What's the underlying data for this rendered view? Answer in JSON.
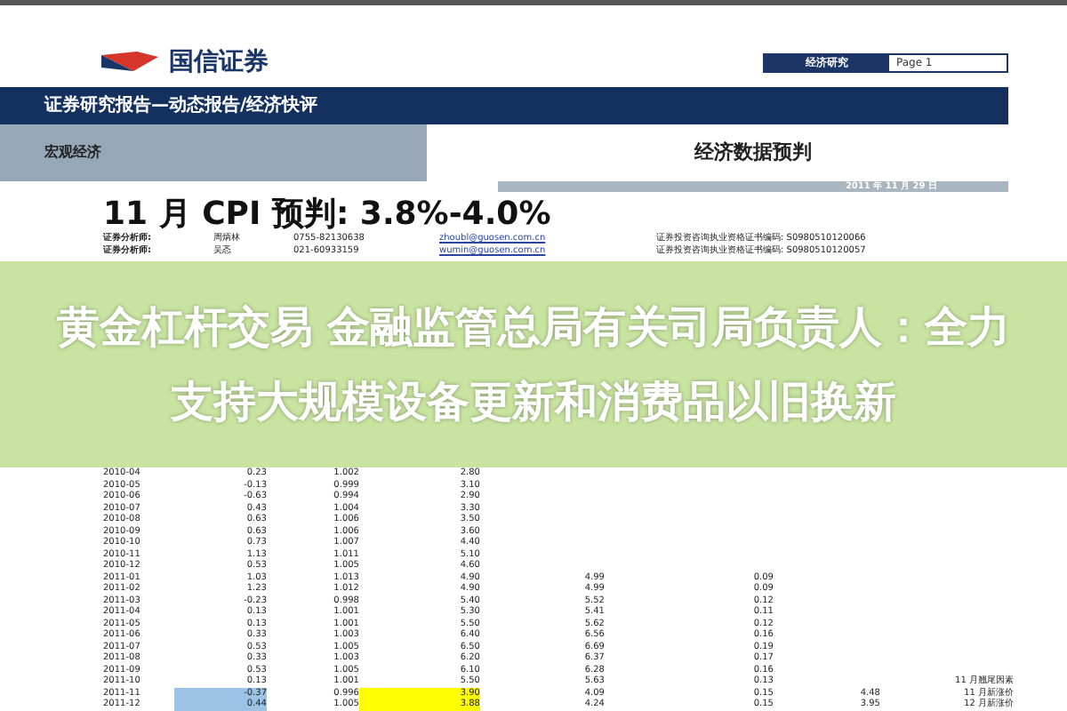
{
  "header": {
    "brand": "国信证券",
    "section_label": "经济研究",
    "page_label": "Page 1"
  },
  "banner": {
    "title": "证券研究报告—动态报告/经济快评"
  },
  "category": {
    "label": "宏观经济",
    "topic": "经济数据预判",
    "date": "2011 年 11 月 29 日"
  },
  "report_title": "11 月 CPI 预判:  3.8%-4.0%",
  "analysts": [
    {
      "role": "证券分析师:",
      "name": "周炳林",
      "phone": "0755-82130638",
      "email": "zhoubl@guosen.com.cn",
      "license": "证券投资咨询执业资格证书编码: S0980510120066"
    },
    {
      "role": "证券分析师:",
      "name": "吴忞",
      "phone": "021-60933159",
      "email": "wumin@guosen.com.cn",
      "license": "证券投资咨询执业资格证书编码: S0980510120057"
    }
  ],
  "headline": "黄金杠杆交易 金融监管总局有关司局负责人：全力支持大规模设备更新和消费品以旧换新",
  "table": {
    "rows": [
      {
        "cells": [
          "2010-04",
          "0.23",
          "1.002",
          "2.80",
          "",
          "",
          "",
          ""
        ],
        "marked": false
      },
      {
        "cells": [
          "2010-05",
          "-0.13",
          "0.999",
          "3.10",
          "",
          "",
          "",
          ""
        ],
        "marked": false
      },
      {
        "cells": [
          "2010-06",
          "-0.63",
          "0.994",
          "2.90",
          "",
          "",
          "",
          ""
        ],
        "marked": false
      },
      {
        "cells": [
          "2010-07",
          "0.43",
          "1.004",
          "3.30",
          "",
          "",
          "",
          ""
        ],
        "marked": false
      },
      {
        "cells": [
          "2010-08",
          "0.63",
          "1.006",
          "3.50",
          "",
          "",
          "",
          ""
        ],
        "marked": false
      },
      {
        "cells": [
          "2010-09",
          "0.63",
          "1.006",
          "3.60",
          "",
          "",
          "",
          ""
        ],
        "marked": false
      },
      {
        "cells": [
          "2010-10",
          "0.73",
          "1.007",
          "4.40",
          "",
          "",
          "",
          ""
        ],
        "marked": false
      },
      {
        "cells": [
          "2010-11",
          "1.13",
          "1.011",
          "5.10",
          "",
          "",
          "",
          ""
        ],
        "marked": false
      },
      {
        "cells": [
          "2010-12",
          "0.53",
          "1.005",
          "4.60",
          "",
          "",
          "",
          ""
        ],
        "marked": false
      },
      {
        "cells": [
          "2011-01",
          "1.03",
          "1.013",
          "4.90",
          "4.99",
          "0.09",
          "",
          ""
        ],
        "marked": false
      },
      {
        "cells": [
          "2011-02",
          "1.23",
          "1.012",
          "4.90",
          "4.99",
          "0.09",
          "",
          ""
        ],
        "marked": false
      },
      {
        "cells": [
          "2011-03",
          "-0.23",
          "0.998",
          "5.40",
          "5.52",
          "0.12",
          "",
          ""
        ],
        "marked": false
      },
      {
        "cells": [
          "2011-04",
          "0.13",
          "1.001",
          "5.30",
          "5.41",
          "0.11",
          "",
          ""
        ],
        "marked": false
      },
      {
        "cells": [
          "2011-05",
          "0.13",
          "1.001",
          "5.50",
          "5.62",
          "0.12",
          "",
          ""
        ],
        "marked": false
      },
      {
        "cells": [
          "2011-06",
          "0.33",
          "1.003",
          "6.40",
          "6.56",
          "0.16",
          "",
          ""
        ],
        "marked": false
      },
      {
        "cells": [
          "2011-07",
          "0.53",
          "1.005",
          "6.50",
          "6.69",
          "0.19",
          "",
          ""
        ],
        "marked": false
      },
      {
        "cells": [
          "2011-08",
          "0.33",
          "1.003",
          "6.20",
          "6.37",
          "0.17",
          "",
          ""
        ],
        "marked": false
      },
      {
        "cells": [
          "2011-09",
          "0.53",
          "1.005",
          "6.10",
          "6.28",
          "0.16",
          "",
          ""
        ],
        "marked": false
      },
      {
        "cells": [
          "2011-10",
          "0.13",
          "1.001",
          "5.50",
          "5.63",
          "0.13",
          "",
          "11 月翘尾因素"
        ],
        "marked": false
      },
      {
        "cells": [
          "2011-11",
          "-0.37",
          "0.996",
          "3.90",
          "4.09",
          "0.15",
          "4.48",
          "11 月新涨价"
        ],
        "marked": true
      },
      {
        "cells": [
          "2011-12",
          "0.44",
          "1.005",
          "3.88",
          "4.24",
          "0.15",
          "3.95",
          "12 月新涨价"
        ],
        "marked": true
      }
    ]
  }
}
